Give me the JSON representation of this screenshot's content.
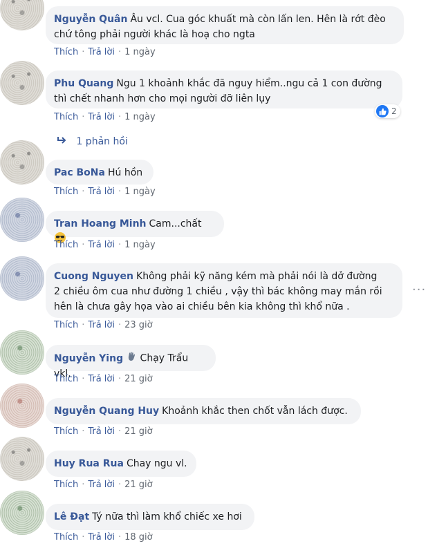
{
  "comments": [
    {
      "author": "Nguyễn Quân",
      "text": "Âu vcl. Cua góc khuất mà còn lấn len. Hên là rớt đèo",
      "text2": "chứ tông phải người khác là hoạ cho ngta",
      "like": "Thích",
      "reply": "Trả lời",
      "time": "1 ngày"
    },
    {
      "author": "Phu Quang",
      "text": "Ngu 1 khoảnh khắc đã nguy hiểm..ngu cả 1 con đường",
      "text2": "thì chết nhanh hơn cho mọi người đỡ liên lụy",
      "like": "Thích",
      "reply": "Trả lời",
      "time": "1 ngày",
      "reaction_count": "2",
      "replies": "1 phản hồi"
    },
    {
      "author": "Pac BoNa",
      "text": "Hú hồn",
      "like": "Thích",
      "reply": "Trả lời",
      "time": "1 ngày"
    },
    {
      "author": "Tran Hoang Minh",
      "text": "Cam...chất",
      "like": "Thích",
      "reply": "Trả lời",
      "time": "1 ngày"
    },
    {
      "author": "Cuong Nguyen",
      "text": "Không phải kỹ năng kém mà phải nói là dở đường",
      "text2": "2 chiều ôm cua như đường 1 chiều , vậy thì bác không may mắn rồi",
      "text3": "hên là chưa gây họa vào ai chiều bên kia không thì khổ nữa .",
      "like": "Thích",
      "reply": "Trả lời",
      "time": "23 giờ"
    },
    {
      "author": "Nguyễn Ying",
      "text": "Chạy Trẩu vkl.",
      "like": "Thích",
      "reply": "Trả lời",
      "time": "21 giờ"
    },
    {
      "author": "Nguyễn Quang Huy",
      "text": "Khoảnh khắc then chốt vẫn lách được.",
      "like": "Thích",
      "reply": "Trả lời",
      "time": "21 giờ"
    },
    {
      "author": "Huy Rua Rua",
      "text": "Chay ngu vl.",
      "like": "Thích",
      "reply": "Trả lời",
      "time": "21 giờ"
    },
    {
      "author": "Lê Đạt",
      "text": "Tý nữa thì làm khổ chiếc xe hơi",
      "like": "Thích",
      "reply": "Trả lời",
      "time": "18 giờ"
    }
  ],
  "separator": "·",
  "icons": {
    "like": "like-thumb-icon",
    "reply_arrow": "reply-arrow-icon",
    "more": "more-options-icon",
    "cool_emoji": "sunglasses-emoji-icon",
    "wave_emoji": "waving-hand-emoji-icon"
  },
  "colors": {
    "author": "#385898",
    "bubble": "#f2f3f5",
    "meta": "#606770",
    "like_blue": "#2078f4"
  }
}
